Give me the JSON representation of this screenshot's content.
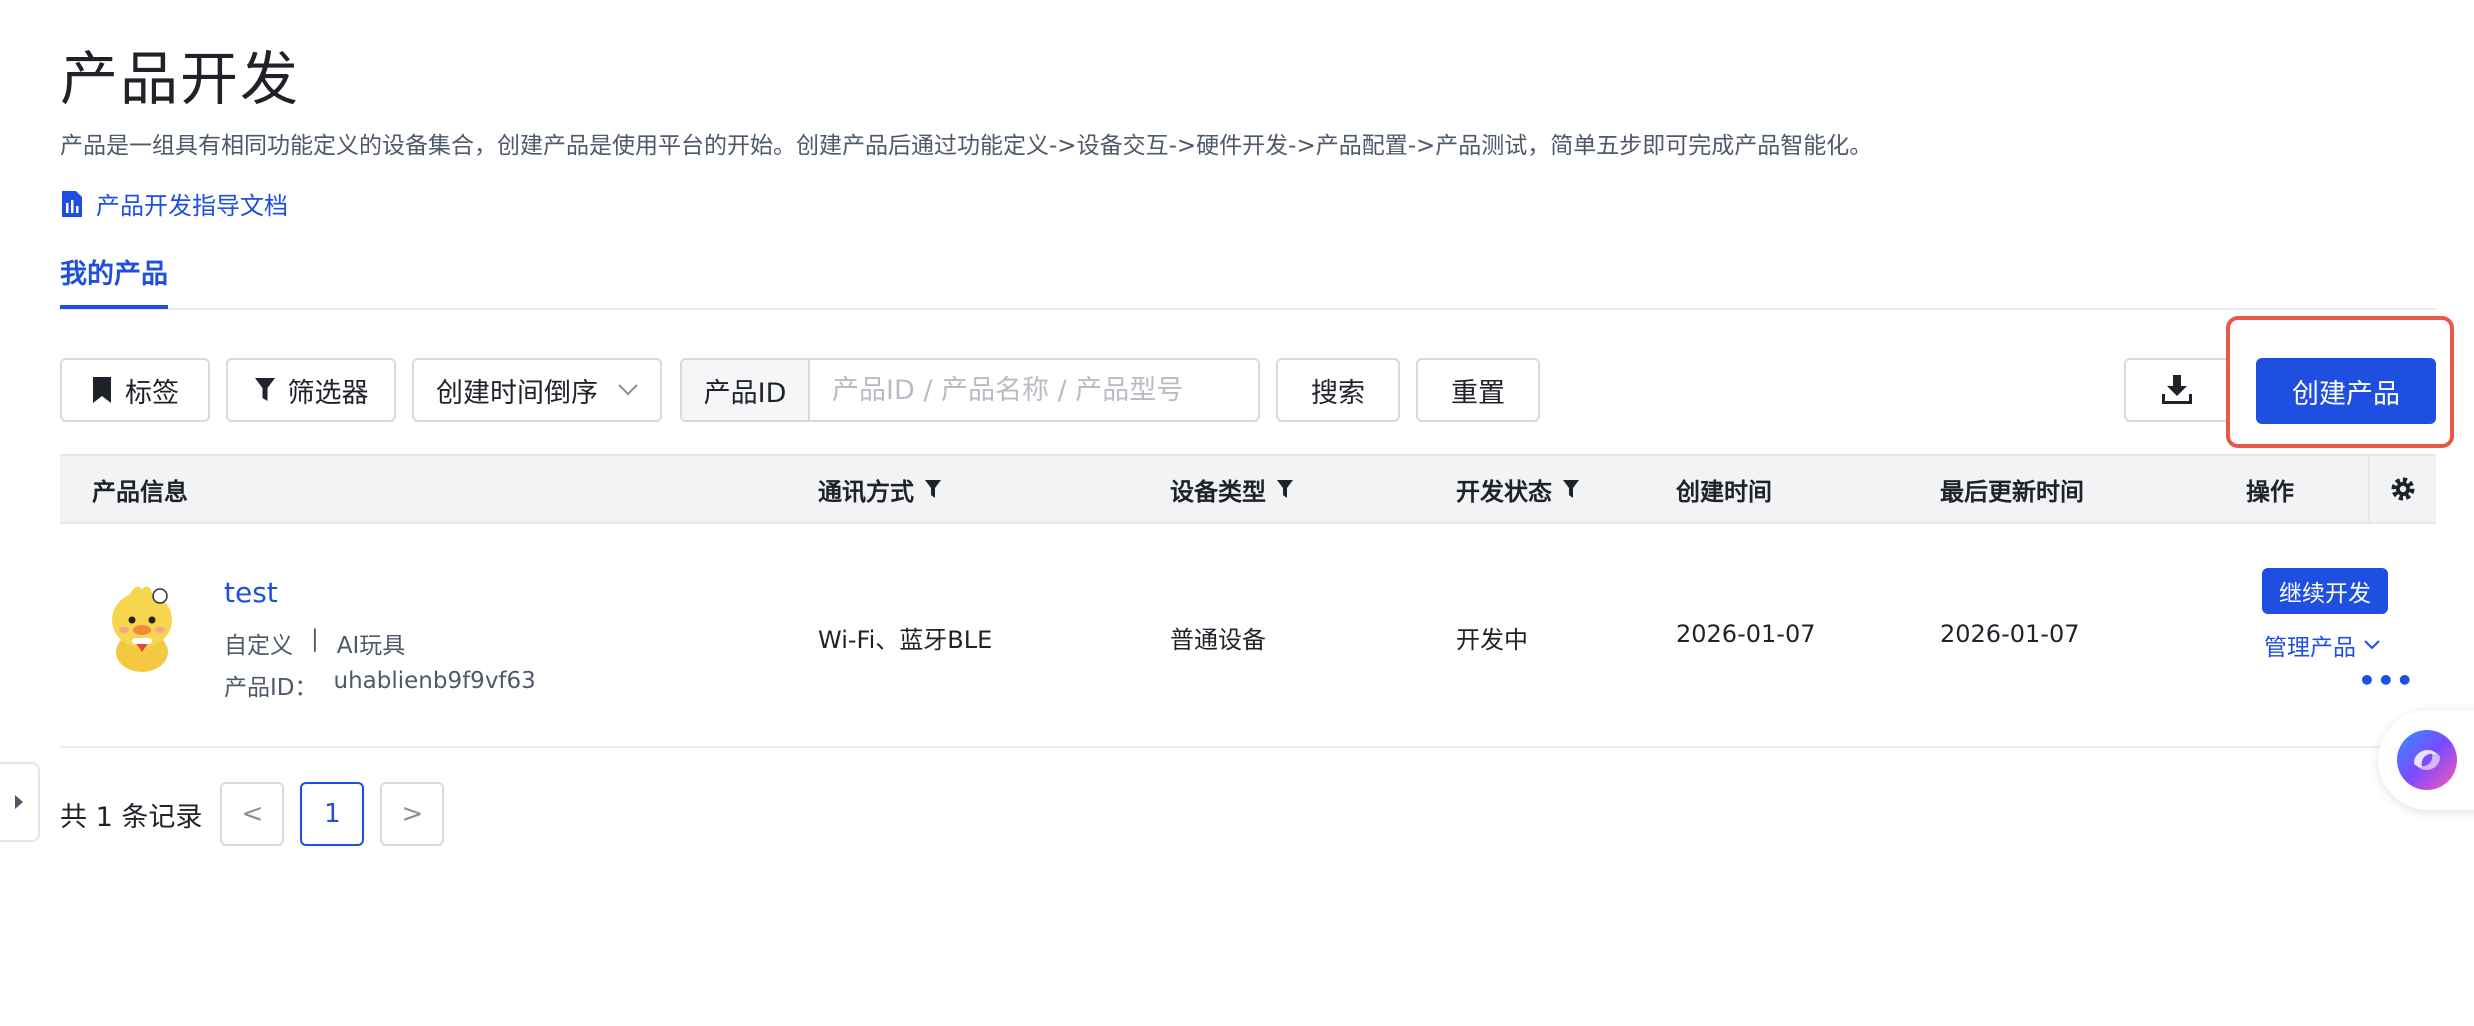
{
  "header": {
    "title": "产品开发",
    "description": "产品是一组具有相同功能定义的设备集合，创建产品是使用平台的开始。创建产品后通过功能定义->设备交互->硬件开发->产品配置->产品测试，简单五步即可完成产品智能化。",
    "doc_link": "产品开发指导文档"
  },
  "tabs": [
    {
      "label": "我的产品",
      "active": true
    }
  ],
  "toolbar": {
    "tag_label": "标签",
    "filter_label": "筛选器",
    "sort_label": "创建时间倒序",
    "search_prefix": "产品ID",
    "search_placeholder": "产品ID / 产品名称 / 产品型号",
    "search_label": "搜索",
    "reset_label": "重置",
    "create_label": "创建产品"
  },
  "table": {
    "columns": [
      "产品信息",
      "通讯方式",
      "设备类型",
      "开发状态",
      "创建时间",
      "最后更新时间",
      "操作"
    ],
    "rows": [
      {
        "name": "test",
        "category": "自定义",
        "subcategory": "AI玩具",
        "id_label": "产品ID：",
        "id": "uhablienb9f9vf63",
        "comm": "Wi-Fi、蓝牙BLE",
        "device_type": "普通设备",
        "status": "开发中",
        "created": "2026-01-07",
        "updated": "2026-01-07",
        "action_primary": "继续开发",
        "action_manage": "管理产品",
        "action_more": "•••"
      }
    ]
  },
  "pagination": {
    "total_text": "共 1 条记录",
    "current_page": "1",
    "prev": "<",
    "next": ">"
  },
  "colors": {
    "primary": "#1f4fe0",
    "highlight": "#e8594a"
  }
}
